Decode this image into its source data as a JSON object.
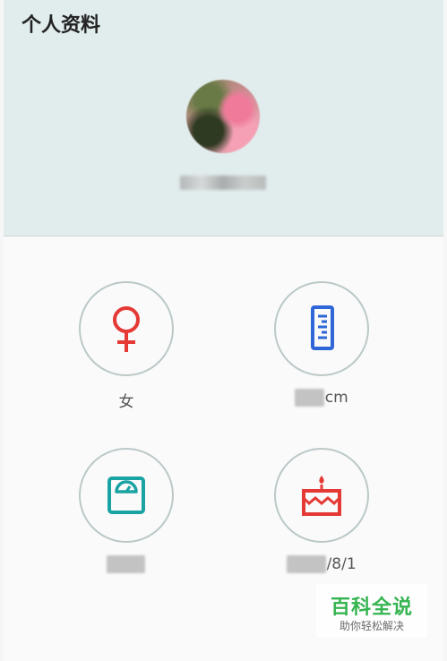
{
  "header": {
    "title": "个人资料",
    "nickname": "",
    "bg_color": "#e1ecec"
  },
  "profile": {
    "gender": {
      "icon": "female-icon",
      "value": "女",
      "color": "#e53935"
    },
    "height": {
      "icon": "ruler-icon",
      "value_visible": "cm",
      "color": "#2f66d8"
    },
    "weight": {
      "icon": "scale-icon",
      "value_visible": "",
      "color": "#1aa3a3"
    },
    "birthday": {
      "icon": "cake-icon",
      "value_visible": "/8/1",
      "color": "#e53935"
    }
  },
  "watermark": {
    "main": "百科全说",
    "sub": "助你轻松解决"
  }
}
